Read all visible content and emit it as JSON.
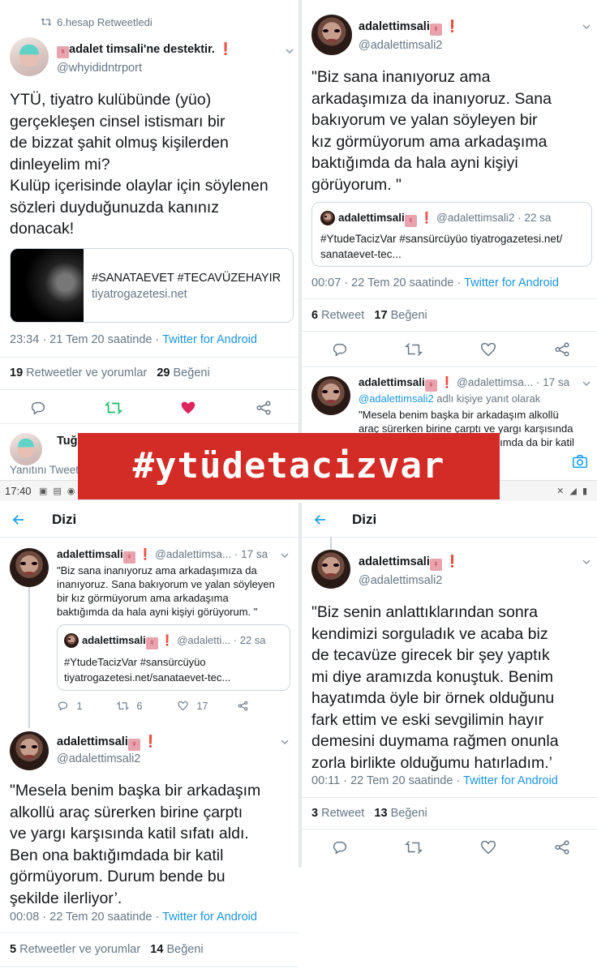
{
  "banner": {
    "hashtag": "#ytüdetacizvar"
  },
  "status_bar": {
    "time": "17:40"
  },
  "top_left": {
    "retweet_note": "6.hesap Retweetledi",
    "author_name": "adalet timsali'ne destektir.",
    "author_handle": "@whyididntrport",
    "text_lines": [
      "YTÜ, tiyatro kulübünde (yüo)",
      "gerçekleşen cinsel istismarı bir",
      "de bizzat şahit olmuş kişilerden",
      "dinleyelim mi?",
      "Kulüp içerisinde olaylar için söylenen",
      "sözleri duyduğunuzda kanınız",
      "donacak!"
    ],
    "card_title": "#SANATAEVET #TECAVÜZEHAYIR",
    "card_domain": "tiyatrogazetesi.net",
    "meta_time": "23:34 · 21 Tem 20 saatinde · ",
    "meta_source": "Twitter for Android",
    "stat_rt_count": "19",
    "stat_rt_label": "Retweetler ve yorumlar",
    "stat_like_count": "29",
    "stat_like_label": "Beğeni",
    "next_name": "Tuğb",
    "reply_placeholder": "Yanıtını Tweet"
  },
  "top_right": {
    "author_name": "adalettimsali",
    "author_handle": "@adalettimsali2",
    "text_lines": [
      "\"Biz sana inanıyoruz ama",
      "arkadaşımıza da inanıyoruz. Sana",
      "bakıyorum ve yalan söyleyen bir",
      "kız görmüyorum ama arkadaşıma",
      "baktığımda da hala ayni kişiyi",
      "görüyorum. \""
    ],
    "quote_name": "adalettimsali",
    "quote_handle": "@adalettimsali2 · 22 sa",
    "quote_lines": [
      "#YtudeTacizVar #sansürcüyüo tiyatrogazetesi.net/",
      "sanataevet-tec..."
    ],
    "meta_time": "00:07 · 22 Tem 20 saatinde · ",
    "meta_source": "Twitter for Android",
    "stat_rt_count": "6",
    "stat_rt_label": "Retweet",
    "stat_like_count": "17",
    "stat_like_label": "Beğeni",
    "reply_name": "adalettimsali",
    "reply_handle": "@adalettimsa... · 17 sa",
    "reply_to": "@adalettimsali2",
    "reply_to_suffix": " adlı kişiye yanıt olarak",
    "reply_lines": [
      "\"Mesela benim başka bir arkadaşım alkollü",
      "araç sürerken birine çarptı ve yargı karşısında",
      "katil sıfatı aldı. Ben ona baktığımda da bir katil"
    ]
  },
  "bottom_left": {
    "nav_title": "Dizi",
    "t1_name": "adalettimsali",
    "t1_handle": "@adalettimsa... · 17 sa",
    "t1_lines": [
      "\"Biz sana inanıyoruz ama arkadaşımıza da",
      "inanıyoruz. Sana bakıyorum ve yalan söyleyen",
      "bir kız görmüyorum ama arkadaşıma",
      "baktığımda da hala ayni kişiyi görüyorum. \""
    ],
    "t1_quote_name": "adalettimsali",
    "t1_quote_handle": "@adaletti... · 22 sa",
    "t1_quote_lines": [
      "#YtudeTacizVar #sansürcüyüo",
      "tiyatrogazetesi.net/sanataevet-tec..."
    ],
    "t1_replies": "1",
    "t1_retweets": "6",
    "t1_likes": "17",
    "t2_name": "adalettimsali",
    "t2_handle": "@adalettimsali2",
    "t2_lines": [
      "\"Mesela benim başka bir arkadaşım",
      "alkollü araç sürerken birine çarptı",
      "ve yargı karşısında katil sıfatı aldı.",
      "Ben ona baktığımdada bir katil",
      "görmüyorum. Durum bende bu",
      "şekilde ilerliyor’."
    ],
    "meta_time": "00:08 · 22 Tem 20 saatinde · ",
    "meta_source": "Twitter for Android",
    "stat_rt_count": "5",
    "stat_rt_label": "Retweetler ve yorumlar",
    "stat_like_count": "14",
    "stat_like_label": "Beğeni"
  },
  "bottom_right": {
    "nav_title": "Dizi",
    "author_name": "adalettimsali",
    "author_handle": "@adalettimsali2",
    "text_lines": [
      "\"Biz senin anlattıklarından sonra",
      "kendimizi sorguladık ve acaba biz",
      "de tecavüze girecek bir şey yaptık",
      "mi diye aramızda konuştuk. Benim",
      "hayatımda öyle bir örnek olduğunu",
      "fark ettim ve eski sevgilimin hayır",
      "demesini duymama rağmen onunla",
      "zorla birlikte olduğumu hatırladım.’"
    ],
    "meta_time": "00:11 · 22 Tem 20 saatinde · ",
    "meta_source": "Twitter for Android",
    "stat_rt_count": "3",
    "stat_rt_label": "Retweet",
    "stat_like_count": "13",
    "stat_like_label": "Beğeni"
  },
  "colors": {
    "accent": "#1da1f2",
    "banner": "#d32b25",
    "like_active": "#e0245e",
    "retweet_active": "#17bf63"
  }
}
